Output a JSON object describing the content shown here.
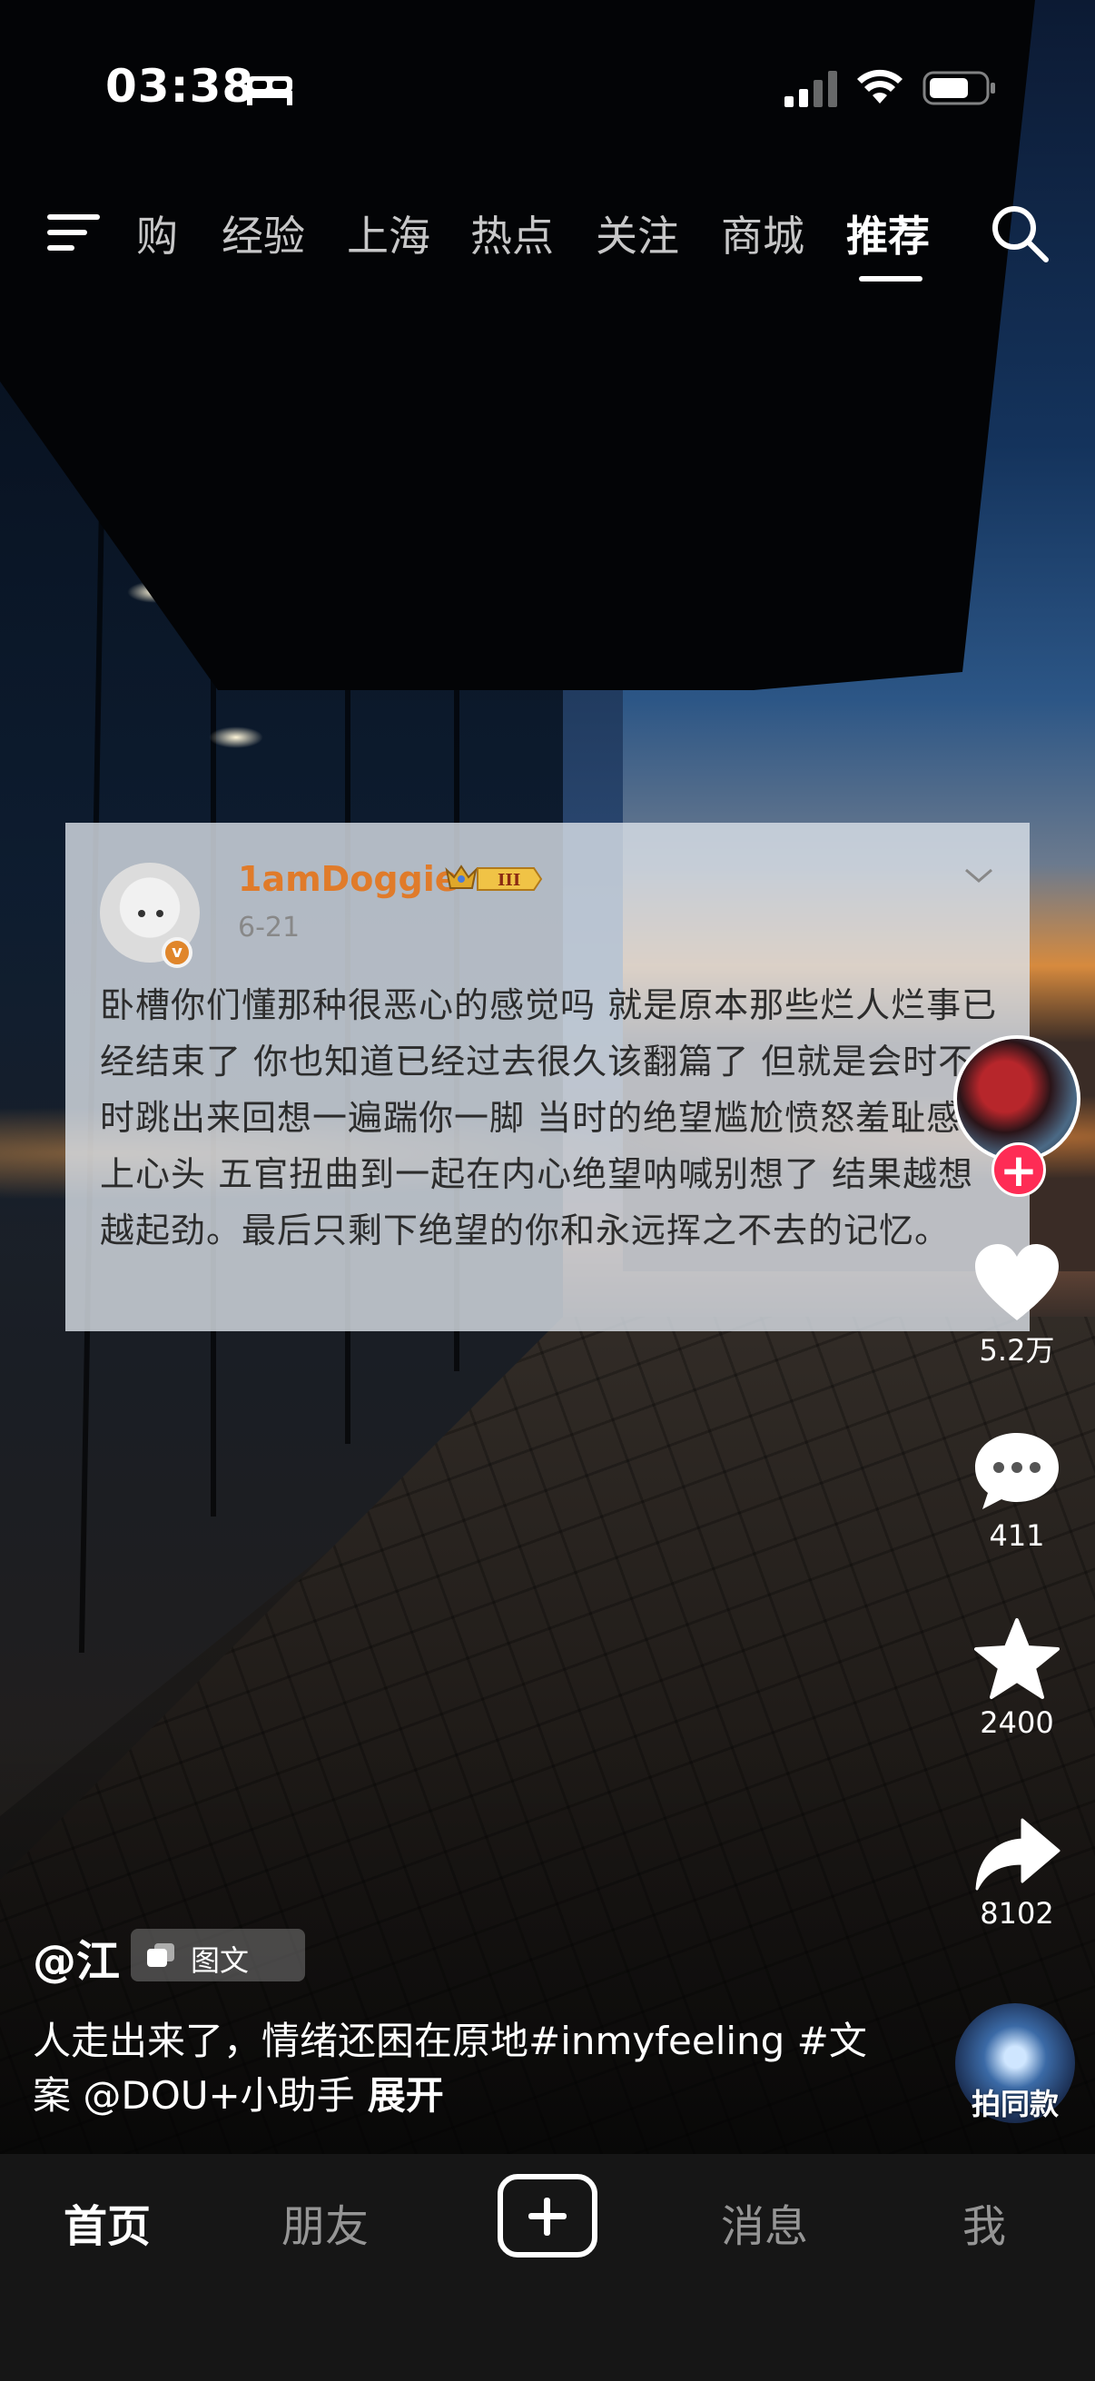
{
  "status_bar": {
    "time": "03:38"
  },
  "top_nav": {
    "tabs": [
      {
        "label": "购"
      },
      {
        "label": "经验"
      },
      {
        "label": "上海"
      },
      {
        "label": "热点"
      },
      {
        "label": "关注"
      },
      {
        "label": "商城"
      },
      {
        "label": "推荐",
        "active": true
      }
    ]
  },
  "post_card": {
    "username": "1amDoggie",
    "level_badge": "III",
    "date": "6-21",
    "text": "卧槽你们懂那种很恶心的感觉吗 就是原本那些烂人烂事已经结束了 你也知道已经过去很久该翻篇了 但就是会时不时跳出来回想一遍踹你一脚 当时的绝望尴尬愤怒羞耻感涌上心头 五官扭曲到一起在内心绝望呐喊别想了 结果越想越起劲。最后只剩下绝望的你和永远挥之不去的记忆。"
  },
  "rail": {
    "likes": "5.2万",
    "comments": "411",
    "favorites": "2400",
    "shares": "8102"
  },
  "video_info": {
    "author": "@江",
    "type_badge": "图文",
    "description": "人走出来了，情绪还困在原地#inmyfeeling #文案 @DOU+小助手",
    "expand_label": "展开",
    "music_label": "拍同款"
  },
  "bottom_nav": {
    "home": "首页",
    "friends": "朋友",
    "messages": "消息",
    "me": "我"
  },
  "colors": {
    "accent_red": "#fe2c55",
    "username_orange": "#e07b2a",
    "nav_bg": "#161616"
  },
  "icons": [
    "bed-icon",
    "signal-icon",
    "wifi-icon",
    "battery-icon",
    "menu-icon",
    "search-icon",
    "chevron-down-icon",
    "heart-icon",
    "comment-icon",
    "star-icon",
    "share-icon",
    "plus-icon",
    "gallery-icon"
  ]
}
